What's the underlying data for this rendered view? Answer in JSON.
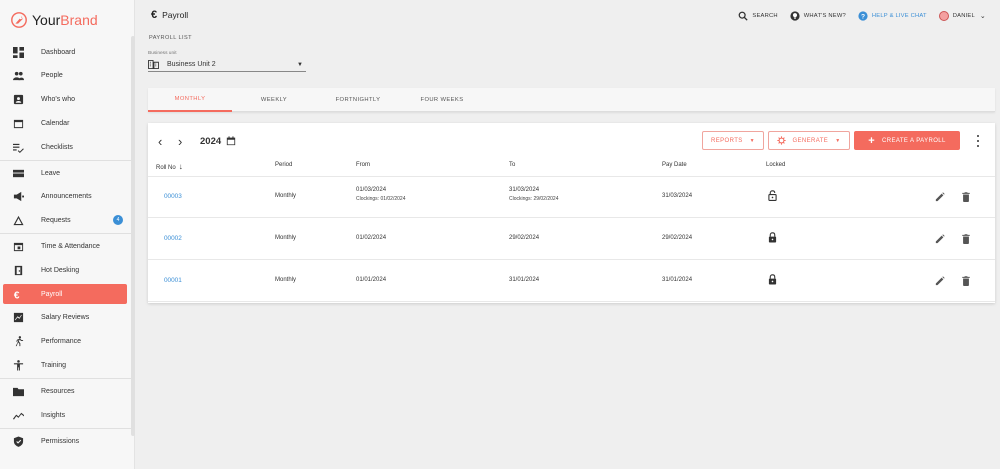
{
  "brand": {
    "prefix": "Your",
    "accent": "Brand"
  },
  "sidebar": {
    "items": [
      {
        "label": "Dashboard",
        "icon": "dashboard-icon"
      },
      {
        "label": "People",
        "icon": "people-icon"
      },
      {
        "label": "Who's who",
        "icon": "contact-card-icon"
      },
      {
        "label": "Calendar",
        "icon": "calendar-icon"
      },
      {
        "label": "Checklists",
        "icon": "checklist-icon"
      },
      {
        "label": "Leave",
        "icon": "leave-icon"
      },
      {
        "label": "Announcements",
        "icon": "megaphone-icon"
      },
      {
        "label": "Requests",
        "icon": "triangle-icon",
        "badge": "4"
      },
      {
        "label": "Time & Attendance",
        "icon": "clock-calendar-icon"
      },
      {
        "label": "Hot Desking",
        "icon": "door-icon"
      },
      {
        "label": "Payroll",
        "icon": "euro-icon",
        "active": true
      },
      {
        "label": "Salary Reviews",
        "icon": "salary-chart-icon"
      },
      {
        "label": "Performance",
        "icon": "running-icon"
      },
      {
        "label": "Training",
        "icon": "person-icon"
      },
      {
        "label": "Resources",
        "icon": "folder-icon"
      },
      {
        "label": "Insights",
        "icon": "trend-icon"
      },
      {
        "label": "Permissions",
        "icon": "shield-icon"
      }
    ]
  },
  "header": {
    "title": "Payroll",
    "search": "SEARCH",
    "whats_new": "WHAT'S NEW?",
    "help": "HELP & LIVE CHAT",
    "user": "DANIEL"
  },
  "payroll_list": {
    "section_label": "PAYROLL LIST",
    "business_unit_label": "Business unit",
    "business_unit_value": "Business Unit 2"
  },
  "tabs": [
    "MONTHLY",
    "WEEKLY",
    "FORTNIGHTLY",
    "FOUR WEEKS"
  ],
  "toolbar": {
    "year": "2024",
    "reports": "REPORTS",
    "generate": "GENERATE",
    "create": "CREATE A PAYROLL"
  },
  "table": {
    "headers": {
      "roll_no": "Roll No",
      "period": "Period",
      "from": "From",
      "to": "To",
      "pay_date": "Pay Date",
      "locked": "Locked"
    },
    "rows": [
      {
        "roll_no": "00003",
        "period": "Monthly",
        "from": "01/03/2024",
        "from_sub": "Clockings: 01/02/2024",
        "to": "31/03/2024",
        "to_sub": "Clockings: 29/02/2024",
        "pay_date": "31/03/2024",
        "locked": false
      },
      {
        "roll_no": "00002",
        "period": "Monthly",
        "from": "01/02/2024",
        "from_sub": "",
        "to": "29/02/2024",
        "to_sub": "",
        "pay_date": "29/02/2024",
        "locked": true
      },
      {
        "roll_no": "00001",
        "period": "Monthly",
        "from": "01/01/2024",
        "from_sub": "",
        "to": "31/01/2024",
        "to_sub": "",
        "pay_date": "31/01/2024",
        "locked": true
      }
    ]
  },
  "colors": {
    "accent": "#f46b5e",
    "link": "#3b8fd6"
  }
}
